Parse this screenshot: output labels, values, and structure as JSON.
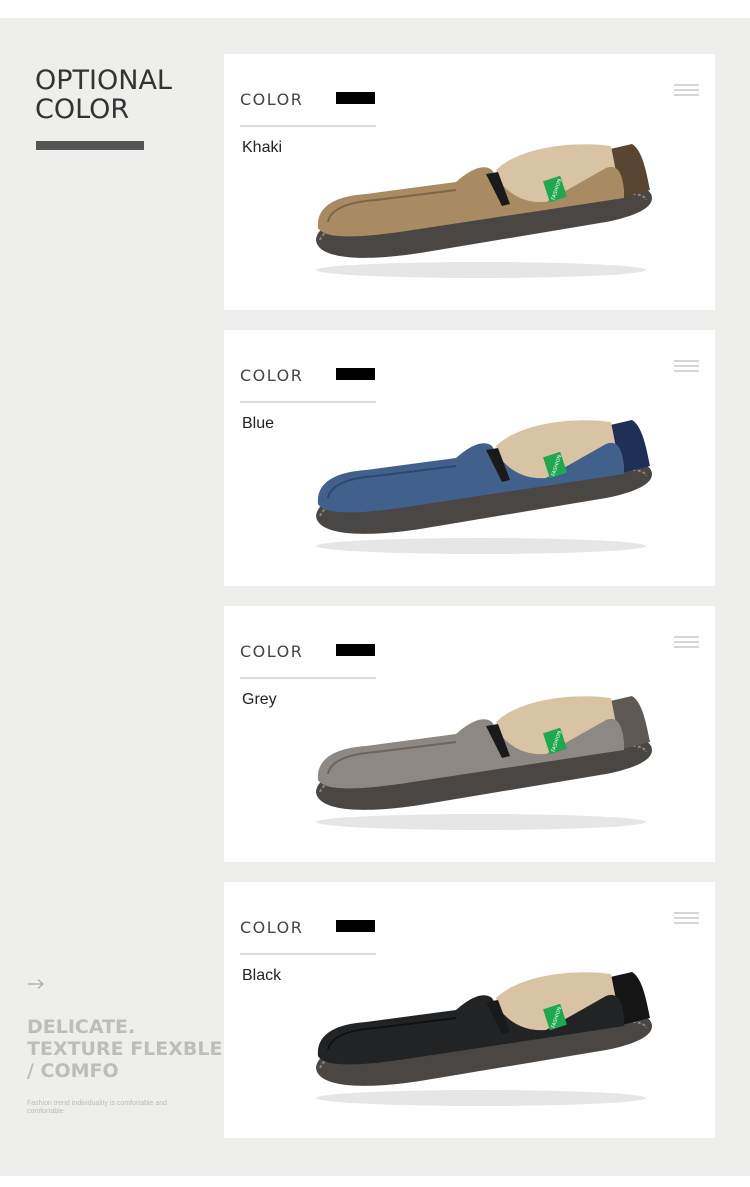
{
  "section": {
    "title_line1": "OPTIONAL",
    "title_line2": "COLOR"
  },
  "tagline": {
    "line1": "DELICATE.",
    "line2": "TEXTURE FLEXBLE",
    "line3": "/ COMFO",
    "sub": "Fashion trend individuality is comfortable and comfortable"
  },
  "products": [
    {
      "color_label": "COLOR",
      "name": "Khaki",
      "swatch": "#000000",
      "upper": "#a88a63",
      "upper_dark": "#7d6545",
      "sole": "#4a4644",
      "heel": "#5a4532"
    },
    {
      "color_label": "COLOR",
      "name": "Blue",
      "swatch": "#000000",
      "upper": "#42608c",
      "upper_dark": "#2c4670",
      "sole": "#4a4644",
      "heel": "#1f2f55"
    },
    {
      "color_label": "COLOR",
      "name": "Grey",
      "swatch": "#000000",
      "upper": "#8d8884",
      "upper_dark": "#6a6561",
      "sole": "#4a4644",
      "heel": "#5e5955"
    },
    {
      "color_label": "COLOR",
      "name": "Black",
      "swatch": "#000000",
      "upper": "#222325",
      "upper_dark": "#101113",
      "sole": "#4a4644",
      "heel": "#151515"
    }
  ],
  "tag_color": "#1fa84f",
  "icons": {
    "menu": "hamburger-icon",
    "arrow": "arrow-right-icon"
  }
}
